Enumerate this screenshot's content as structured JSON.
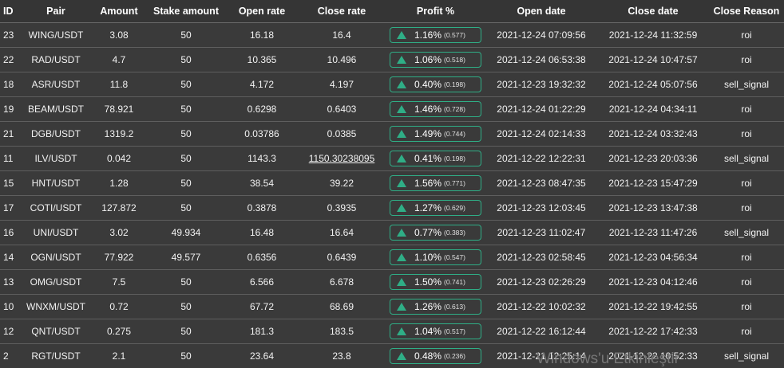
{
  "columns": [
    "ID",
    "Pair",
    "Amount",
    "Stake amount",
    "Open rate",
    "Close rate",
    "Profit %",
    "Open date",
    "Close date",
    "Close Reason"
  ],
  "colors": {
    "background": "#3a3a3a",
    "profit_accent": "#2fae86",
    "row_divider": "#5e5e5e"
  },
  "icons": {
    "profit_indicator": "triangle-up-icon"
  },
  "rows": [
    {
      "id": "23",
      "pair": "WING/USDT",
      "amount": "3.08",
      "stake": "50",
      "open_rate": "16.18",
      "close_rate": "16.4",
      "profit": "1.16%",
      "ratio": "(0.577)",
      "open_date": "2021-12-24 07:09:56",
      "close_date": "2021-12-24 11:32:59",
      "reason": "roi"
    },
    {
      "id": "22",
      "pair": "RAD/USDT",
      "amount": "4.7",
      "stake": "50",
      "open_rate": "10.365",
      "close_rate": "10.496",
      "profit": "1.06%",
      "ratio": "(0.518)",
      "open_date": "2021-12-24 06:53:38",
      "close_date": "2021-12-24 10:47:57",
      "reason": "roi"
    },
    {
      "id": "18",
      "pair": "ASR/USDT",
      "amount": "11.8",
      "stake": "50",
      "open_rate": "4.172",
      "close_rate": "4.197",
      "profit": "0.40%",
      "ratio": "(0.198)",
      "open_date": "2021-12-23 19:32:32",
      "close_date": "2021-12-24 05:07:56",
      "reason": "sell_signal"
    },
    {
      "id": "19",
      "pair": "BEAM/USDT",
      "amount": "78.921",
      "stake": "50",
      "open_rate": "0.6298",
      "close_rate": "0.6403",
      "profit": "1.46%",
      "ratio": "(0.728)",
      "open_date": "2021-12-24 01:22:29",
      "close_date": "2021-12-24 04:34:11",
      "reason": "roi"
    },
    {
      "id": "21",
      "pair": "DGB/USDT",
      "amount": "1319.2",
      "stake": "50",
      "open_rate": "0.03786",
      "close_rate": "0.0385",
      "profit": "1.49%",
      "ratio": "(0.744)",
      "open_date": "2021-12-24 02:14:33",
      "close_date": "2021-12-24 03:32:43",
      "reason": "roi"
    },
    {
      "id": "11",
      "pair": "ILV/USDT",
      "amount": "0.042",
      "stake": "50",
      "open_rate": "1143.3",
      "close_rate": "1150.30238095",
      "profit": "0.41%",
      "ratio": "(0.198)",
      "open_date": "2021-12-22 12:22:31",
      "close_date": "2021-12-23 20:03:36",
      "reason": "sell_signal",
      "close_rate_underlined": true
    },
    {
      "id": "15",
      "pair": "HNT/USDT",
      "amount": "1.28",
      "stake": "50",
      "open_rate": "38.54",
      "close_rate": "39.22",
      "profit": "1.56%",
      "ratio": "(0.771)",
      "open_date": "2021-12-23 08:47:35",
      "close_date": "2021-12-23 15:47:29",
      "reason": "roi"
    },
    {
      "id": "17",
      "pair": "COTI/USDT",
      "amount": "127.872",
      "stake": "50",
      "open_rate": "0.3878",
      "close_rate": "0.3935",
      "profit": "1.27%",
      "ratio": "(0.629)",
      "open_date": "2021-12-23 12:03:45",
      "close_date": "2021-12-23 13:47:38",
      "reason": "roi"
    },
    {
      "id": "16",
      "pair": "UNI/USDT",
      "amount": "3.02",
      "stake": "49.934",
      "open_rate": "16.48",
      "close_rate": "16.64",
      "profit": "0.77%",
      "ratio": "(0.383)",
      "open_date": "2021-12-23 11:02:47",
      "close_date": "2021-12-23 11:47:26",
      "reason": "sell_signal"
    },
    {
      "id": "14",
      "pair": "OGN/USDT",
      "amount": "77.922",
      "stake": "49.577",
      "open_rate": "0.6356",
      "close_rate": "0.6439",
      "profit": "1.10%",
      "ratio": "(0.547)",
      "open_date": "2021-12-23 02:58:45",
      "close_date": "2021-12-23 04:56:34",
      "reason": "roi"
    },
    {
      "id": "13",
      "pair": "OMG/USDT",
      "amount": "7.5",
      "stake": "50",
      "open_rate": "6.566",
      "close_rate": "6.678",
      "profit": "1.50%",
      "ratio": "(0.741)",
      "open_date": "2021-12-23 02:26:29",
      "close_date": "2021-12-23 04:12:46",
      "reason": "roi"
    },
    {
      "id": "10",
      "pair": "WNXM/USDT",
      "amount": "0.72",
      "stake": "50",
      "open_rate": "67.72",
      "close_rate": "68.69",
      "profit": "1.26%",
      "ratio": "(0.613)",
      "open_date": "2021-12-22 10:02:32",
      "close_date": "2021-12-22 19:42:55",
      "reason": "roi"
    },
    {
      "id": "12",
      "pair": "QNT/USDT",
      "amount": "0.275",
      "stake": "50",
      "open_rate": "181.3",
      "close_rate": "183.5",
      "profit": "1.04%",
      "ratio": "(0.517)",
      "open_date": "2021-12-22 16:12:44",
      "close_date": "2021-12-22 17:42:33",
      "reason": "roi"
    },
    {
      "id": "2",
      "pair": "RGT/USDT",
      "amount": "2.1",
      "stake": "50",
      "open_rate": "23.64",
      "close_rate": "23.8",
      "profit": "0.48%",
      "ratio": "(0.236)",
      "open_date": "2021-12-21 12:25:14",
      "close_date": "2021-12-22 10:52:33",
      "reason": "sell_signal"
    }
  ],
  "watermark": "Windows'u Etkinleştir"
}
